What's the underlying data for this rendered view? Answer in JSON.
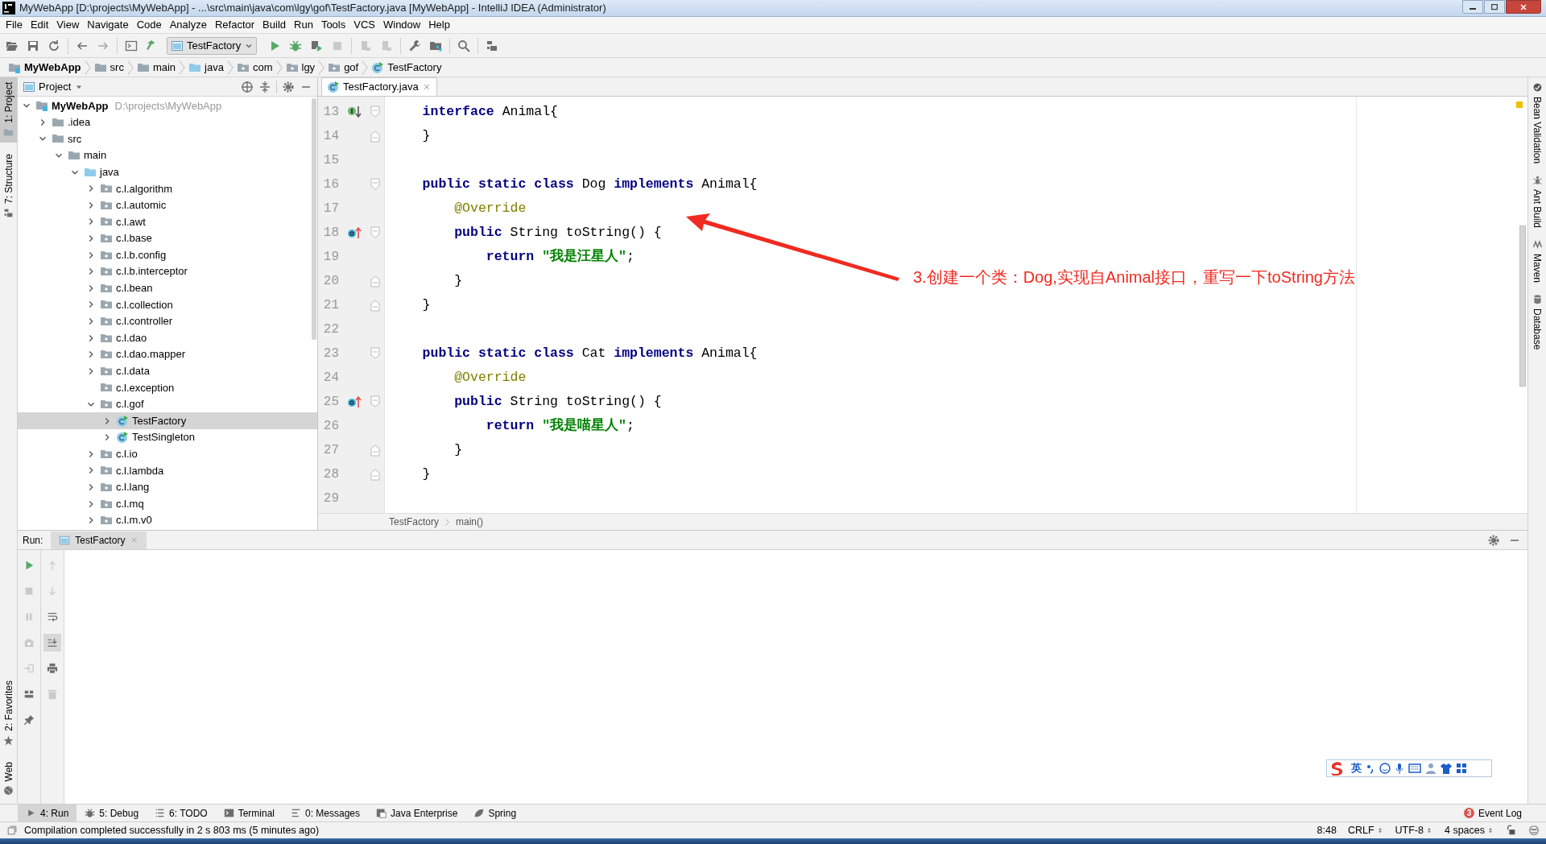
{
  "window": {
    "title": "MyWebApp [D:\\projects\\MyWebApp] - ...\\src\\main\\java\\com\\lgy\\gof\\TestFactory.java [MyWebApp] - IntelliJ IDEA (Administrator)"
  },
  "menu": [
    "File",
    "Edit",
    "View",
    "Navigate",
    "Code",
    "Analyze",
    "Refactor",
    "Build",
    "Run",
    "Tools",
    "VCS",
    "Window",
    "Help"
  ],
  "toolbar": {
    "run_config": "TestFactory"
  },
  "nav_bar": [
    {
      "label": "MyWebApp",
      "kind": "module"
    },
    {
      "label": "src",
      "kind": "folder"
    },
    {
      "label": "main",
      "kind": "folder"
    },
    {
      "label": "java",
      "kind": "source-folder"
    },
    {
      "label": "com",
      "kind": "package"
    },
    {
      "label": "lgy",
      "kind": "package"
    },
    {
      "label": "gof",
      "kind": "package"
    },
    {
      "label": "TestFactory",
      "kind": "class"
    }
  ],
  "left_tool_strip": {
    "top": [
      {
        "label": "1: Project",
        "selected": true
      },
      {
        "label": "7: Structure",
        "selected": false
      }
    ],
    "bottom": [
      {
        "label": "2: Favorites",
        "selected": false
      },
      {
        "label": "Web",
        "selected": false
      }
    ]
  },
  "project_panel": {
    "title": "Project",
    "tree": [
      {
        "label": "MyWebApp",
        "hint": "D:\\projects\\MyWebApp",
        "kind": "module",
        "expanded": true,
        "selected": false,
        "children": [
          {
            "label": ".idea",
            "kind": "folder",
            "expanded": false,
            "selected": false
          },
          {
            "label": "src",
            "kind": "folder",
            "expanded": true,
            "selected": false,
            "children": [
              {
                "label": "main",
                "kind": "folder",
                "expanded": true,
                "selected": false,
                "children": [
                  {
                    "label": "java",
                    "kind": "source-folder",
                    "expanded": true,
                    "selected": false,
                    "children": [
                      {
                        "label": "c.l.algorithm",
                        "kind": "package",
                        "expanded": false,
                        "selected": false
                      },
                      {
                        "label": "c.l.automic",
                        "kind": "package",
                        "expanded": false,
                        "selected": false
                      },
                      {
                        "label": "c.l.awt",
                        "kind": "package",
                        "expanded": false,
                        "selected": false
                      },
                      {
                        "label": "c.l.base",
                        "kind": "package",
                        "expanded": false,
                        "selected": false
                      },
                      {
                        "label": "c.l.b.config",
                        "kind": "package",
                        "expanded": false,
                        "selected": false
                      },
                      {
                        "label": "c.l.b.interceptor",
                        "kind": "package",
                        "expanded": false,
                        "selected": false
                      },
                      {
                        "label": "c.l.bean",
                        "kind": "package",
                        "expanded": false,
                        "selected": false
                      },
                      {
                        "label": "c.l.collection",
                        "kind": "package",
                        "expanded": false,
                        "selected": false
                      },
                      {
                        "label": "c.l.controller",
                        "kind": "package",
                        "expanded": false,
                        "selected": false
                      },
                      {
                        "label": "c.l.dao",
                        "kind": "package",
                        "expanded": false,
                        "selected": false
                      },
                      {
                        "label": "c.l.dao.mapper",
                        "kind": "package",
                        "expanded": false,
                        "selected": false
                      },
                      {
                        "label": "c.l.data",
                        "kind": "package",
                        "expanded": false,
                        "selected": false
                      },
                      {
                        "label": "c.l.exception",
                        "kind": "package",
                        "selected": false
                      },
                      {
                        "label": "c.l.gof",
                        "kind": "package",
                        "expanded": true,
                        "selected": false,
                        "children": [
                          {
                            "label": "TestFactory",
                            "kind": "class",
                            "expanded": false,
                            "selected": true
                          },
                          {
                            "label": "TestSingleton",
                            "kind": "class",
                            "expanded": false,
                            "selected": false
                          }
                        ]
                      },
                      {
                        "label": "c.l.io",
                        "kind": "package",
                        "expanded": false,
                        "selected": false
                      },
                      {
                        "label": "c.l.lambda",
                        "kind": "package",
                        "expanded": false,
                        "selected": false
                      },
                      {
                        "label": "c.l.lang",
                        "kind": "package",
                        "expanded": false,
                        "selected": false
                      },
                      {
                        "label": "c.l.mq",
                        "kind": "package",
                        "expanded": false,
                        "selected": false
                      },
                      {
                        "label": "c.l.m.v0",
                        "kind": "package",
                        "expanded": false,
                        "selected": false
                      }
                    ]
                  }
                ]
              }
            ]
          }
        ]
      }
    ]
  },
  "editor": {
    "tabs": [
      {
        "label": "TestFactory.java",
        "selected": true
      }
    ],
    "lines": [
      {
        "number": "13",
        "implemented": true,
        "overrides": false,
        "fold_start": true,
        "fold_end": false,
        "tokens": [
          {
            "kind": "keyword",
            "text": "    interface"
          },
          {
            "kind": "plain",
            "text": " Animal{"
          }
        ]
      },
      {
        "number": "14",
        "implemented": false,
        "overrides": false,
        "fold_start": false,
        "fold_end": true,
        "tokens": [
          {
            "kind": "plain",
            "text": "    }"
          }
        ]
      },
      {
        "number": "15",
        "implemented": false,
        "overrides": false,
        "fold_start": false,
        "fold_end": false
      },
      {
        "number": "16",
        "implemented": false,
        "overrides": false,
        "fold_start": true,
        "fold_end": false,
        "tokens": [
          {
            "kind": "keyword",
            "text": "    public static class"
          },
          {
            "kind": "plain",
            "text": " Dog "
          },
          {
            "kind": "keyword",
            "text": "implements"
          },
          {
            "kind": "plain",
            "text": " Animal{"
          }
        ]
      },
      {
        "number": "17",
        "implemented": false,
        "overrides": false,
        "fold_start": false,
        "fold_end": false,
        "tokens": [
          {
            "kind": "annotation",
            "text": "        @Override"
          }
        ]
      },
      {
        "number": "18",
        "implemented": false,
        "overrides": true,
        "fold_start": true,
        "fold_end": false,
        "tokens": [
          {
            "kind": "keyword",
            "text": "        public"
          },
          {
            "kind": "plain",
            "text": " String toString() {"
          }
        ]
      },
      {
        "number": "19",
        "implemented": false,
        "overrides": false,
        "fold_start": false,
        "fold_end": false,
        "tokens": [
          {
            "kind": "keyword",
            "text": "            return "
          },
          {
            "kind": "string",
            "text": "\"我是汪星人\""
          },
          {
            "kind": "plain",
            "text": ";"
          }
        ]
      },
      {
        "number": "20",
        "implemented": false,
        "overrides": false,
        "fold_start": false,
        "fold_end": true,
        "tokens": [
          {
            "kind": "plain",
            "text": "        }"
          }
        ]
      },
      {
        "number": "21",
        "implemented": false,
        "overrides": false,
        "fold_start": false,
        "fold_end": true,
        "tokens": [
          {
            "kind": "plain",
            "text": "    }"
          }
        ]
      },
      {
        "number": "22",
        "implemented": false,
        "overrides": false,
        "fold_start": false,
        "fold_end": false
      },
      {
        "number": "23",
        "implemented": false,
        "overrides": false,
        "fold_start": true,
        "fold_end": false,
        "tokens": [
          {
            "kind": "keyword",
            "text": "    public static class"
          },
          {
            "kind": "plain",
            "text": " Cat "
          },
          {
            "kind": "keyword",
            "text": "implements"
          },
          {
            "kind": "plain",
            "text": " Animal{"
          }
        ]
      },
      {
        "number": "24",
        "implemented": false,
        "overrides": false,
        "fold_start": false,
        "fold_end": false,
        "tokens": [
          {
            "kind": "annotation",
            "text": "        @Override"
          }
        ]
      },
      {
        "number": "25",
        "implemented": false,
        "overrides": true,
        "fold_start": true,
        "fold_end": false,
        "tokens": [
          {
            "kind": "keyword",
            "text": "        public"
          },
          {
            "kind": "plain",
            "text": " String toString() {"
          }
        ]
      },
      {
        "number": "26",
        "implemented": false,
        "overrides": false,
        "fold_start": false,
        "fold_end": false,
        "tokens": [
          {
            "kind": "keyword",
            "text": "            return "
          },
          {
            "kind": "string",
            "text": "\"我是喵星人\""
          },
          {
            "kind": "plain",
            "text": ";"
          }
        ]
      },
      {
        "number": "27",
        "implemented": false,
        "overrides": false,
        "fold_start": false,
        "fold_end": true,
        "tokens": [
          {
            "kind": "plain",
            "text": "        }"
          }
        ]
      },
      {
        "number": "28",
        "implemented": false,
        "overrides": false,
        "fold_start": false,
        "fold_end": true,
        "tokens": [
          {
            "kind": "plain",
            "text": "    }"
          }
        ]
      },
      {
        "number": "29",
        "implemented": false,
        "overrides": false,
        "fold_start": false,
        "fold_end": false
      }
    ],
    "breadcrumb": [
      "TestFactory",
      "main()"
    ]
  },
  "annotation": {
    "text": "3.创建一个类：Dog,实现自Animal接口，重写一下toString方法"
  },
  "right_tool_strip": [
    {
      "label": "Bean Validation"
    },
    {
      "label": "Ant Build"
    },
    {
      "label": "Maven"
    },
    {
      "label": "Database"
    }
  ],
  "run_panel": {
    "label": "Run:",
    "tabs": [
      {
        "label": "TestFactory",
        "selected": true
      }
    ]
  },
  "ime_bar": {
    "mode": "英"
  },
  "bottom_tool_tabs": [
    {
      "label": "4: Run",
      "selected": true
    },
    {
      "label": "5: Debug",
      "selected": false
    },
    {
      "label": "6: TODO",
      "selected": false
    },
    {
      "label": "Terminal",
      "selected": false
    },
    {
      "label": "0: Messages",
      "selected": false
    },
    {
      "label": "Java Enterprise",
      "selected": false
    },
    {
      "label": "Spring",
      "selected": false
    }
  ],
  "event_log": {
    "label": "Event Log",
    "count": "3"
  },
  "status_bar": {
    "message": "Compilation completed successfully in 2 s 803 ms (5 minutes ago)",
    "position": "8:48",
    "line_separator": "CRLF",
    "encoding": "UTF-8",
    "indent": "4 spaces"
  }
}
